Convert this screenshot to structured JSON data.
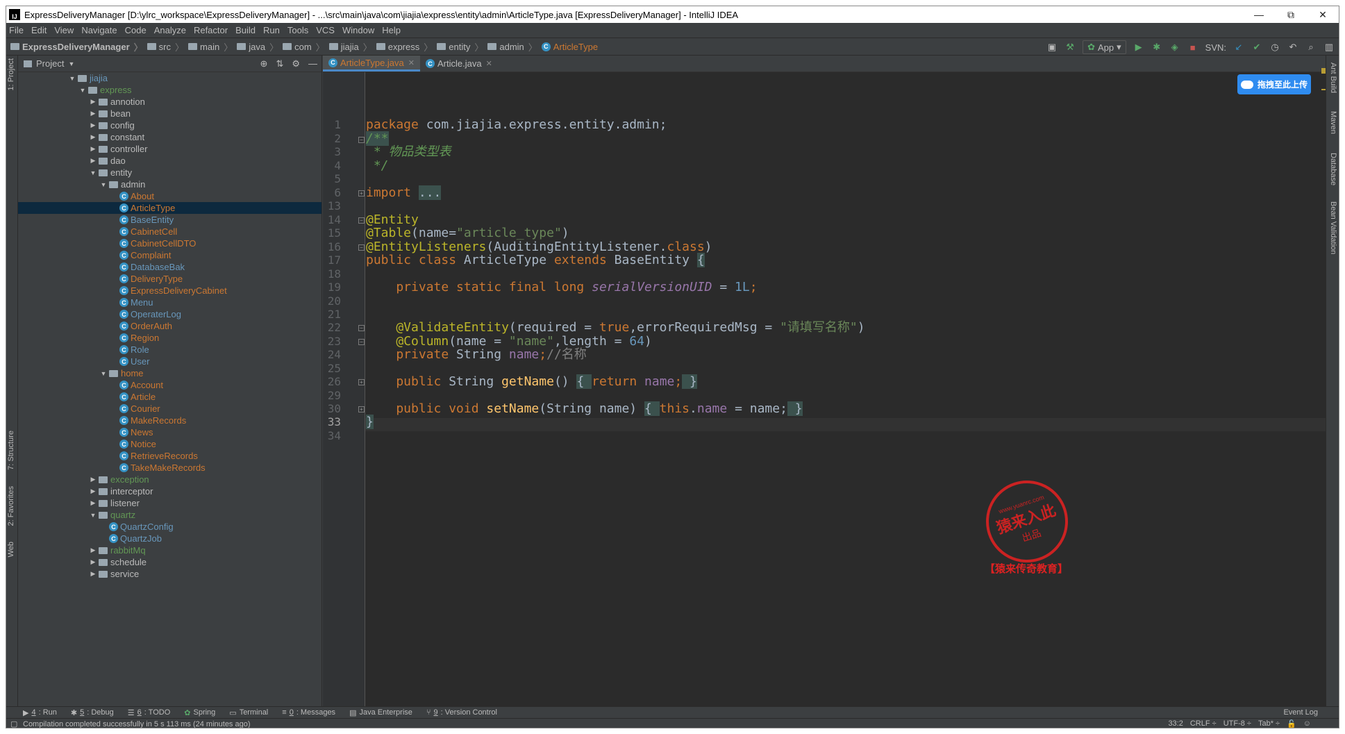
{
  "window": {
    "title": "ExpressDeliveryManager [D:\\ylrc_workspace\\ExpressDeliveryManager] - ...\\src\\main\\java\\com\\jiajia\\express\\entity\\admin\\ArticleType.java [ExpressDeliveryManager] - IntelliJ IDEA",
    "app_icon_text": "IJ",
    "minimize": "—",
    "maximize": "⧉",
    "close": "✕"
  },
  "menu": [
    "File",
    "Edit",
    "View",
    "Navigate",
    "Code",
    "Analyze",
    "Refactor",
    "Build",
    "Run",
    "Tools",
    "VCS",
    "Window",
    "Help"
  ],
  "breadcrumbs": [
    "ExpressDeliveryManager",
    "src",
    "main",
    "java",
    "com",
    "jiajia",
    "express",
    "entity",
    "admin",
    "ArticleType"
  ],
  "toolbar": {
    "run_config": "App",
    "svn_label": "SVN:"
  },
  "project_panel": {
    "title": "Project",
    "tree": [
      {
        "label": "jiajia",
        "depth": 0,
        "kind": "folder",
        "expanded": true,
        "color": "blue"
      },
      {
        "label": "express",
        "depth": 1,
        "kind": "folder",
        "expanded": true,
        "color": "green"
      },
      {
        "label": "annotion",
        "depth": 2,
        "kind": "folder",
        "expanded": false,
        "color": "plain"
      },
      {
        "label": "bean",
        "depth": 2,
        "kind": "folder",
        "expanded": false,
        "color": "plain"
      },
      {
        "label": "config",
        "depth": 2,
        "kind": "folder",
        "expanded": false,
        "color": "plain"
      },
      {
        "label": "constant",
        "depth": 2,
        "kind": "folder",
        "expanded": false,
        "color": "plain"
      },
      {
        "label": "controller",
        "depth": 2,
        "kind": "folder",
        "expanded": false,
        "color": "plain"
      },
      {
        "label": "dao",
        "depth": 2,
        "kind": "folder",
        "expanded": false,
        "color": "plain"
      },
      {
        "label": "entity",
        "depth": 2,
        "kind": "folder",
        "expanded": true,
        "color": "plain"
      },
      {
        "label": "admin",
        "depth": 3,
        "kind": "folder",
        "expanded": true,
        "color": "plain"
      },
      {
        "label": "About",
        "depth": 4,
        "kind": "class",
        "color": "orange"
      },
      {
        "label": "ArticleType",
        "depth": 4,
        "kind": "class",
        "color": "orange",
        "selected": true
      },
      {
        "label": "BaseEntity",
        "depth": 4,
        "kind": "class",
        "color": "blue"
      },
      {
        "label": "CabinetCell",
        "depth": 4,
        "kind": "class",
        "color": "orange"
      },
      {
        "label": "CabinetCellDTO",
        "depth": 4,
        "kind": "class",
        "color": "orange"
      },
      {
        "label": "Complaint",
        "depth": 4,
        "kind": "class",
        "color": "orange"
      },
      {
        "label": "DatabaseBak",
        "depth": 4,
        "kind": "class",
        "color": "blue"
      },
      {
        "label": "DeliveryType",
        "depth": 4,
        "kind": "class",
        "color": "orange"
      },
      {
        "label": "ExpressDeliveryCabinet",
        "depth": 4,
        "kind": "class",
        "color": "orange"
      },
      {
        "label": "Menu",
        "depth": 4,
        "kind": "class",
        "color": "blue"
      },
      {
        "label": "OperaterLog",
        "depth": 4,
        "kind": "class",
        "color": "blue"
      },
      {
        "label": "OrderAuth",
        "depth": 4,
        "kind": "class",
        "color": "orange"
      },
      {
        "label": "Region",
        "depth": 4,
        "kind": "class",
        "color": "orange"
      },
      {
        "label": "Role",
        "depth": 4,
        "kind": "class",
        "color": "blue"
      },
      {
        "label": "User",
        "depth": 4,
        "kind": "class",
        "color": "blue"
      },
      {
        "label": "home",
        "depth": 3,
        "kind": "folder",
        "expanded": true,
        "color": "orange"
      },
      {
        "label": "Account",
        "depth": 4,
        "kind": "class",
        "color": "orange"
      },
      {
        "label": "Article",
        "depth": 4,
        "kind": "class",
        "color": "orange"
      },
      {
        "label": "Courier",
        "depth": 4,
        "kind": "class",
        "color": "orange"
      },
      {
        "label": "MakeRecords",
        "depth": 4,
        "kind": "class",
        "color": "orange"
      },
      {
        "label": "News",
        "depth": 4,
        "kind": "class",
        "color": "orange"
      },
      {
        "label": "Notice",
        "depth": 4,
        "kind": "class",
        "color": "orange"
      },
      {
        "label": "RetrieveRecords",
        "depth": 4,
        "kind": "class",
        "color": "orange"
      },
      {
        "label": "TakeMakeRecords",
        "depth": 4,
        "kind": "class",
        "color": "orange"
      },
      {
        "label": "exception",
        "depth": 2,
        "kind": "folder",
        "expanded": false,
        "color": "green"
      },
      {
        "label": "interceptor",
        "depth": 2,
        "kind": "folder",
        "expanded": false,
        "color": "plain"
      },
      {
        "label": "listener",
        "depth": 2,
        "kind": "folder",
        "expanded": false,
        "color": "plain"
      },
      {
        "label": "quartz",
        "depth": 2,
        "kind": "folder",
        "expanded": true,
        "color": "green"
      },
      {
        "label": "QuartzConfig",
        "depth": 3,
        "kind": "class",
        "color": "blue"
      },
      {
        "label": "QuartzJob",
        "depth": 3,
        "kind": "class",
        "color": "blue"
      },
      {
        "label": "rabbitMq",
        "depth": 2,
        "kind": "folder",
        "expanded": false,
        "color": "green"
      },
      {
        "label": "schedule",
        "depth": 2,
        "kind": "folder",
        "expanded": false,
        "color": "plain"
      },
      {
        "label": "service",
        "depth": 2,
        "kind": "folder",
        "expanded": false,
        "color": "plain"
      }
    ]
  },
  "editor": {
    "tabs": [
      {
        "label": "ArticleType.java",
        "active": true
      },
      {
        "label": "Article.java",
        "active": false
      }
    ],
    "line_numbers": [
      "1",
      "2",
      "3",
      "4",
      "5",
      "6",
      "13",
      "14",
      "15",
      "16",
      "17",
      "18",
      "19",
      "20",
      "21",
      "22",
      "23",
      "24",
      "25",
      "26",
      "29",
      "30",
      "33",
      "34"
    ],
    "current_line": "33",
    "code": {
      "l1_kw": "package",
      "l1_rest": " com.jiajia.express.entity.admin;",
      "l2": "/**",
      "l3": " * 物品类型表",
      "l4": " */",
      "l6_kw": "import",
      "l6_fold": "...",
      "l14": "@Entity",
      "l15_ann": "@Table",
      "l15_a": "(name=",
      "l15_str": "\"article_type\"",
      "l15_b": ")",
      "l16_ann": "@EntityListeners",
      "l16_a": "(AuditingEntityListener.",
      "l16_kw": "class",
      "l16_b": ")",
      "l17_kw1": "public class",
      "l17_a": " ArticleType ",
      "l17_kw2": "extends",
      "l17_b": " BaseEntity ",
      "l17_brace": "{",
      "l19_kw": "    private static final long",
      "l19_fld": "serialVersionUID",
      "l19_a": " = ",
      "l19_num": "1L",
      "l19_b": ";",
      "l22_ann": "    @ValidateEntity",
      "l22_a": "(required = ",
      "l22_kw": "true",
      "l22_b": ",errorRequiredMsg = ",
      "l22_str": "\"请填写名称\"",
      "l22_c": ")",
      "l23_ann": "    @Column",
      "l23_a": "(name = ",
      "l23_str": "\"name\"",
      "l23_b": ",length = ",
      "l23_num": "64",
      "l23_c": ")",
      "l24_kw": "    private",
      "l24_a": " String ",
      "l24_fld": "name",
      "l24_b": ";",
      "l24_cmt": "//名称",
      "l26_kw": "    public",
      "l26_a": " String ",
      "l26_fn": "getName",
      "l26_b": "() ",
      "l26_f1": "{ ",
      "l26_kw2": "return",
      "l26_c": " ",
      "l26_fld": "name",
      "l26_d": ";",
      "l26_f2": " }",
      "l30_kw": "    public void",
      "l30_a": " ",
      "l30_fn": "setName",
      "l30_b": "(String name) ",
      "l30_f1": "{ ",
      "l30_kw2": "this",
      "l30_c": ".",
      "l30_fld": "name",
      "l30_d": " = name;",
      "l30_f2": " }",
      "l33": "}"
    },
    "cloud_button": "拖拽至此上传"
  },
  "right_tools": [
    "Ant Build",
    "Maven",
    "Database",
    "Bean Validation"
  ],
  "left_tools": [
    "1: Project",
    "7: Structure",
    "2: Favorites",
    "Web"
  ],
  "bottom_tools": [
    {
      "num": "4",
      "label": ": Run"
    },
    {
      "num": "5",
      "label": ": Debug"
    },
    {
      "num": "6",
      "label": ": TODO"
    },
    {
      "num": "",
      "label": "Spring"
    },
    {
      "num": "",
      "label": "Terminal"
    },
    {
      "num": "0",
      "label": ": Messages"
    },
    {
      "num": "",
      "label": "Java Enterprise"
    },
    {
      "num": "9",
      "label": ": Version Control"
    }
  ],
  "event_log": "Event Log",
  "status": {
    "message": "Compilation completed successfully in 5 s 113 ms (24 minutes ago)",
    "position": "33:2",
    "line_sep": "CRLF ÷",
    "encoding": "UTF-8 ÷",
    "indent": "Tab* ÷"
  },
  "watermark": {
    "url": "www.yuanrc.com",
    "main": "猿来入此",
    "sub": "出品",
    "caption": "【猿来传奇教育】"
  },
  "colors": {
    "background": "#2b2b2b",
    "panel": "#3c3f41",
    "keyword": "#cc7832",
    "annotation": "#bbb529",
    "string": "#6a8759",
    "selection": "#0d293e",
    "accent": "#4a88c7"
  }
}
